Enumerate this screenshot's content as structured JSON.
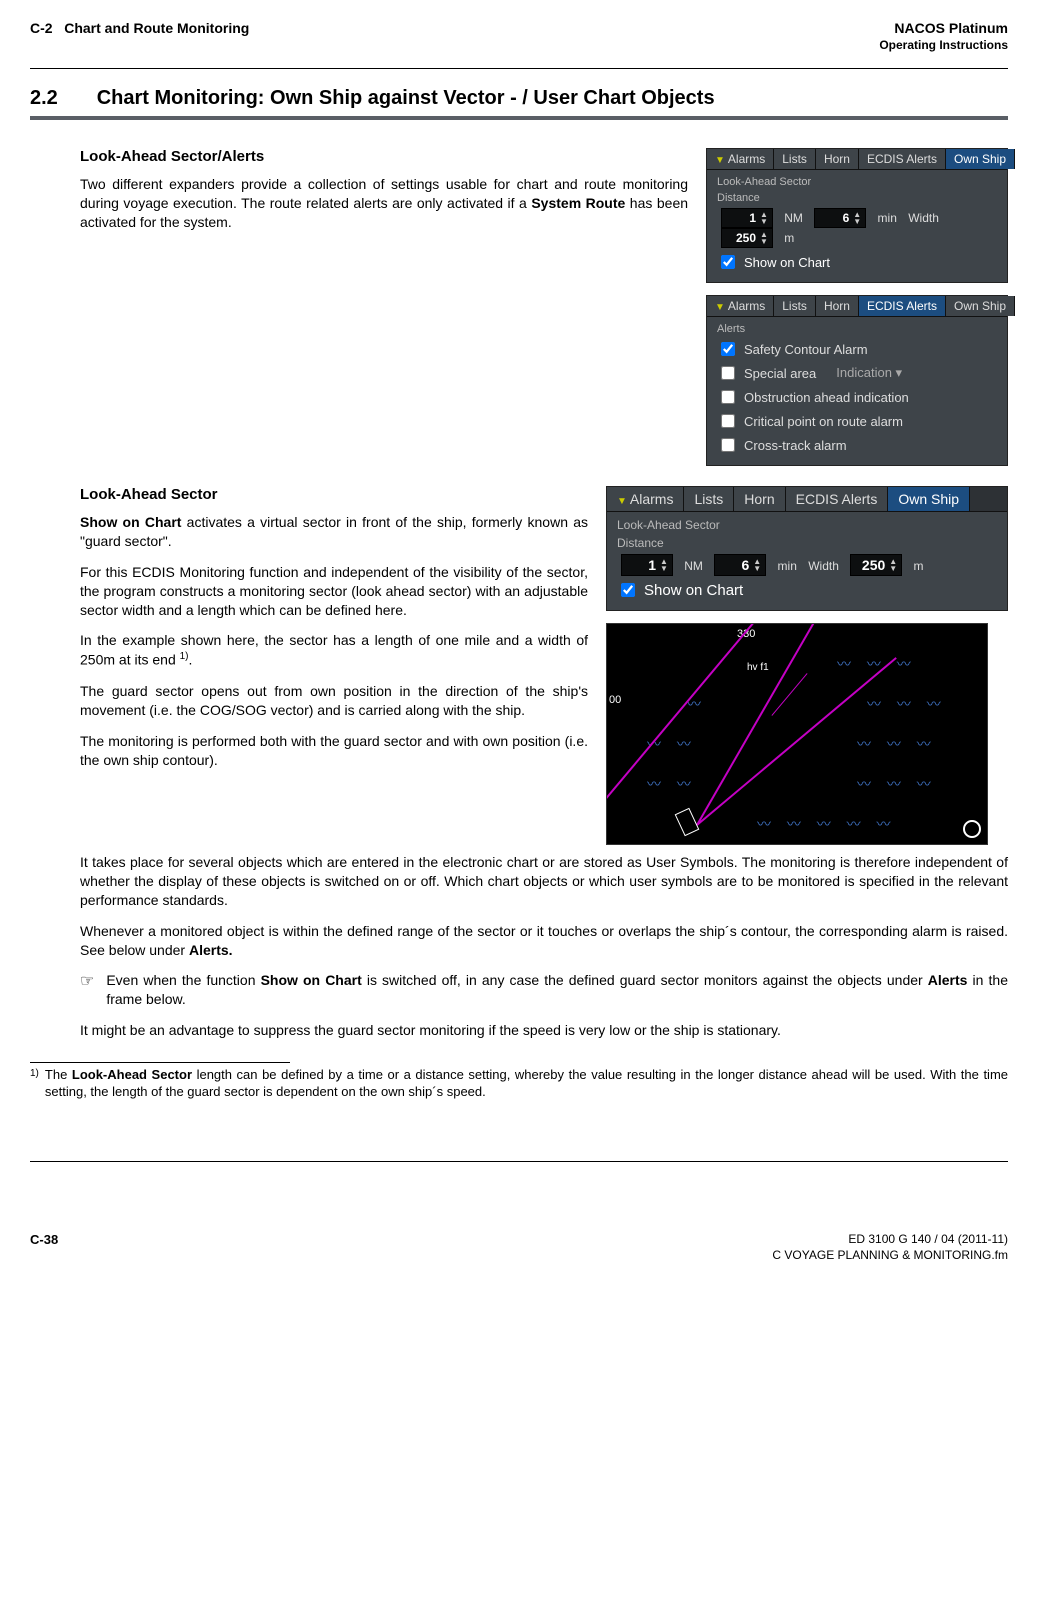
{
  "header": {
    "chapter": "C-2",
    "chapter_title": "Chart and Route Monitoring",
    "product": "NACOS Platinum",
    "sub": "Operating Instructions"
  },
  "section": {
    "num": "2.2",
    "title": "Chart Monitoring: Own Ship against Vector - / User Chart Objects"
  },
  "sub1": {
    "heading": "Look-Ahead Sector/Alerts",
    "para1a": "Two different expanders provide a collection of settings usable for chart and route monitoring during voyage execution. The route related alerts are only activated if a ",
    "para1b": "System Route",
    "para1c": " has been activated for the system."
  },
  "sub2": {
    "heading": "Look-Ahead Sector",
    "p1a": "Show on Chart",
    "p1b": " activates a virtual sector in front of the ship, formerly known as \"guard sector\".",
    "p2": "For this ECDIS Monitoring function and independent of the visibility of the sector, the program constructs a monitoring sector (look ahead sector) with an adjustable sector width and a length which can be defined here.",
    "p3a": "In the example shown here, the sector has a length of one mile and a width of 250m at its end ",
    "p3sup": "1)",
    "p3b": ".",
    "p4": "The guard sector opens out from own position in the direction of the ship's movement (i.e. the COG/SOG vector) and is carried along with the ship.",
    "p5": "The monitoring is performed both with the guard sector and with own position (i.e. the own ship contour).",
    "p6": "It takes place for several objects which are entered in the electronic chart or are stored as User Symbols. The monitoring is therefore independent of whether the display of these objects is switched on or off. Which chart objects or which user symbols are to be monitored is specified in the relevant performance standards.",
    "p7a": "Whenever a monitored object is within the defined range of the sector or it touches or overlaps the ship´s contour, the corresponding alarm is raised. See below under ",
    "p7b": "Alerts.",
    "note_icon": "☞",
    "note_a": "Even when the function ",
    "note_b": "Show on Chart",
    "note_c": " is switched off, in any case the defined guard sector monitors against the objects under ",
    "note_d": "Alerts",
    "note_e": " in the frame below.",
    "p8": "It might be an advantage to suppress the guard sector monitoring if the speed is very low or the ship is stationary."
  },
  "footnote": {
    "num": "1)",
    "a": "The ",
    "b": "Look-Ahead Sector",
    "c": " length can be defined by a time or a distance setting, whereby the value resulting in the longer distance ahead will be used. With the time setting, the length of the guard sector is dependent on the own ship´s speed."
  },
  "footer": {
    "page": "C-38",
    "doc": "ED 3100 G 140 / 04 (2011-11)",
    "file": "C VOYAGE PLANNING & MONITORING.fm"
  },
  "ui": {
    "tabs": {
      "alarms": "Alarms",
      "lists": "Lists",
      "horn": "Horn",
      "ecdis": "ECDIS Alerts",
      "own": "Own Ship"
    },
    "panel1": {
      "group": "Look-Ahead Sector",
      "dist_lbl": "Distance",
      "nm": "1",
      "nm_unit": "NM",
      "min": "6",
      "min_unit": "min",
      "width_lbl": "Width",
      "width": "250",
      "width_unit": "m",
      "show": "Show on Chart"
    },
    "panel2": {
      "group": "Alerts",
      "i1": "Safety Contour Alarm",
      "i2": "Special area",
      "i2drop": "Indication",
      "i3": "Obstruction ahead indication",
      "i4": "Critical point on route alarm",
      "i5": "Cross-track alarm"
    },
    "sector": {
      "deg": "330",
      "hv": "hv f1",
      "zero": "00"
    }
  }
}
